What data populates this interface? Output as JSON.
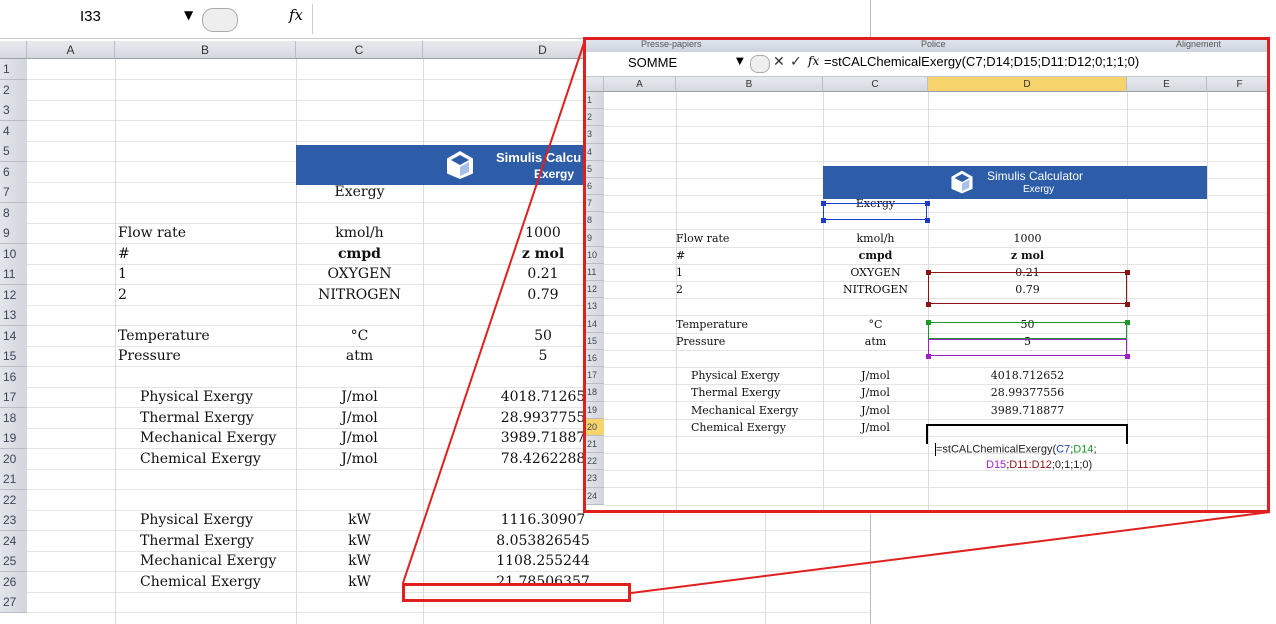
{
  "main": {
    "name_box": "I33",
    "fx_label": "fx",
    "columns": [
      "A",
      "B",
      "C",
      "D"
    ],
    "rows": [
      "1",
      "2",
      "3",
      "4",
      "5",
      "6",
      "7",
      "8",
      "9",
      "10",
      "11",
      "12",
      "13",
      "14",
      "15",
      "16",
      "17",
      "18",
      "19",
      "20",
      "21",
      "22",
      "23",
      "24",
      "25",
      "26",
      "27"
    ],
    "banner_title": "Simulis Calcu",
    "banner_sub": "Exergy",
    "c7": "Exergy",
    "r9": {
      "b": "Flow rate",
      "c": "kmol/h",
      "d": "1000"
    },
    "r10": {
      "b": "#",
      "c": "cmpd",
      "d": "z mol"
    },
    "r11": {
      "b": "1",
      "c": "OXYGEN",
      "d": "0.21"
    },
    "r12": {
      "b": "2",
      "c": "NITROGEN",
      "d": "0.79"
    },
    "r14": {
      "b": "Temperature",
      "c": "°C",
      "d": "50"
    },
    "r15": {
      "b": "Pressure",
      "c": "atm",
      "d": "5"
    },
    "r17": {
      "b": "Physical Exergy",
      "c": "J/mol",
      "d": "4018.71265"
    },
    "r18": {
      "b": "Thermal Exergy",
      "c": "J/mol",
      "d": "28.9937755"
    },
    "r19": {
      "b": "Mechanical Exergy",
      "c": "J/mol",
      "d": "3989.71887"
    },
    "r20": {
      "b": "Chemical Exergy",
      "c": "J/mol",
      "d": "78.4262288"
    },
    "r23": {
      "b": "Physical Exergy",
      "c": "kW",
      "d": "1116.30907"
    },
    "r24": {
      "b": "Thermal Exergy",
      "c": "kW",
      "d": "8.053826545"
    },
    "r25": {
      "b": "Mechanical Exergy",
      "c": "kW",
      "d": "1108.255244"
    },
    "r26": {
      "b": "Chemical Exergy",
      "c": "kW",
      "d": "21.78506357"
    }
  },
  "inset": {
    "ribbon_left": "Presse-papiers",
    "ribbon_mid": "Police",
    "ribbon_right": "Alignement",
    "name_box": "SOMME",
    "cancel": "✕",
    "enter": "✓",
    "fx_label": "fx",
    "formula": "=stCALChemicalExergy(C7;D14;D15;D11:D12;0;1;1;0)",
    "columns": [
      "A",
      "B",
      "C",
      "D",
      "E",
      "F"
    ],
    "rows": [
      "1",
      "2",
      "3",
      "4",
      "5",
      "6",
      "7",
      "8",
      "9",
      "10",
      "11",
      "12",
      "13",
      "14",
      "15",
      "16",
      "17",
      "18",
      "19",
      "20",
      "21",
      "22",
      "23",
      "24"
    ],
    "banner_title": "Simulis Calculator",
    "banner_sub": "Exergy",
    "c7": "Exergy",
    "r9": {
      "b": "Flow rate",
      "c": "kmol/h",
      "d": "1000"
    },
    "r10": {
      "b": "#",
      "c": "cmpd",
      "d": "z mol"
    },
    "r11": {
      "b": "1",
      "c": "OXYGEN",
      "d": "0.21"
    },
    "r12": {
      "b": "2",
      "c": "NITROGEN",
      "d": "0.79"
    },
    "r14": {
      "b": "Temperature",
      "c": "°C",
      "d": "50"
    },
    "r15": {
      "b": "Pressure",
      "c": "atm",
      "d": "5"
    },
    "r17": {
      "b": "Physical Exergy",
      "c": "J/mol",
      "d": "4018.712652"
    },
    "r18": {
      "b": "Thermal Exergy",
      "c": "J/mol",
      "d": "28.99377556"
    },
    "r19": {
      "b": "Mechanical Exergy",
      "c": "J/mol",
      "d": "3989.718877"
    },
    "r20": {
      "b": "Chemical Exergy",
      "c": "J/mol"
    },
    "edit_line1_prefix": "=stCALChemicalExergy(",
    "edit_c7": "C7",
    "edit_d14": "D14",
    "edit_line2_d15": "D15",
    "edit_d11": "D11:D12",
    "edit_tail": ";0;1;1;0)"
  },
  "colors": {
    "highlight": "#e0201e",
    "banner": "#2d5ca8"
  }
}
